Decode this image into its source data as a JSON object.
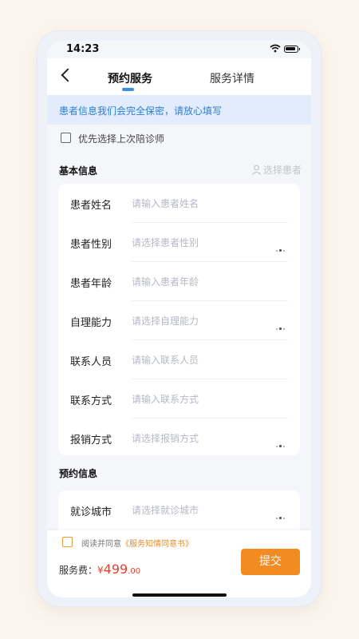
{
  "status_bar": {
    "time": "14:23"
  },
  "nav": {
    "tabs": [
      {
        "label": "预约服务",
        "active": true
      },
      {
        "label": "服务详情",
        "active": false
      }
    ]
  },
  "notice": "患者信息我们会完全保密，请放心填写",
  "prefer_checkbox": {
    "label": "优先选择上次陪诊师",
    "checked": false
  },
  "basic_info": {
    "title": "基本信息",
    "select_patient": "选择患者",
    "fields": [
      {
        "label": "患者姓名",
        "placeholder": "请输入患者姓名",
        "has_more": false
      },
      {
        "label": "患者性别",
        "placeholder": "请选择患者性别",
        "has_more": true
      },
      {
        "label": "患者年龄",
        "placeholder": "请输入患者年龄",
        "has_more": false
      },
      {
        "label": "自理能力",
        "placeholder": "请选择自理能力",
        "has_more": true
      },
      {
        "label": "联系人员",
        "placeholder": "请输入联系人员",
        "has_more": false
      },
      {
        "label": "联系方式",
        "placeholder": "请输入联系方式",
        "has_more": false
      },
      {
        "label": "报销方式",
        "placeholder": "请选择报销方式",
        "has_more": true
      }
    ]
  },
  "appointment_info": {
    "title": "预约信息",
    "fields": [
      {
        "label": "就诊城市",
        "placeholder": "请选择就诊城市",
        "has_more": true
      }
    ]
  },
  "footer": {
    "agree_prefix": "阅读并同意",
    "agree_link": "《服务知情同意书》",
    "agree_checked": false,
    "fee_label": "服务费：",
    "currency": "¥",
    "price_int": "499",
    "price_dec": ".00",
    "submit_label": "提交"
  },
  "colors": {
    "accent_blue": "#3b8fe3",
    "notice_bg": "#e2ecfa",
    "submit_orange": "#f18b22",
    "price_red": "#e2412f"
  }
}
